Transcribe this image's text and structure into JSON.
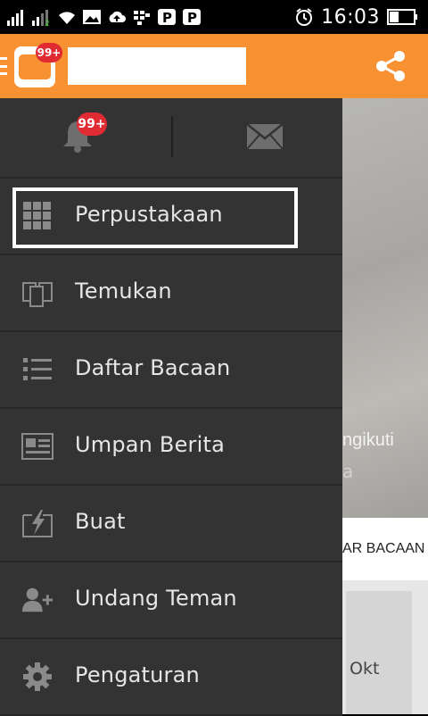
{
  "status_bar": {
    "time": "16:03"
  },
  "app_bar": {
    "notification_badge": "99+",
    "search_placeholder": ""
  },
  "drawer": {
    "bell_badge": "99+",
    "items": [
      {
        "label": "Perpustakaan",
        "icon": "grid-icon"
      },
      {
        "label": "Temukan",
        "icon": "discover-cards-icon"
      },
      {
        "label": "Daftar Bacaan",
        "icon": "list-icon"
      },
      {
        "label": "Umpan Berita",
        "icon": "news-feed-icon"
      },
      {
        "label": "Buat",
        "icon": "create-lightning-icon"
      },
      {
        "label": "Undang Teman",
        "icon": "add-person-icon"
      },
      {
        "label": "Pengaturan",
        "icon": "gear-icon"
      }
    ],
    "selected_index": 0
  },
  "background": {
    "photo_text_line1": "ngikuti",
    "photo_text_line2": "a",
    "tab_label": "AR BACAAN",
    "card_text": "Okt"
  },
  "colors": {
    "accent": "#f79131",
    "drawer_bg": "#333333",
    "badge": "#e02b33"
  }
}
